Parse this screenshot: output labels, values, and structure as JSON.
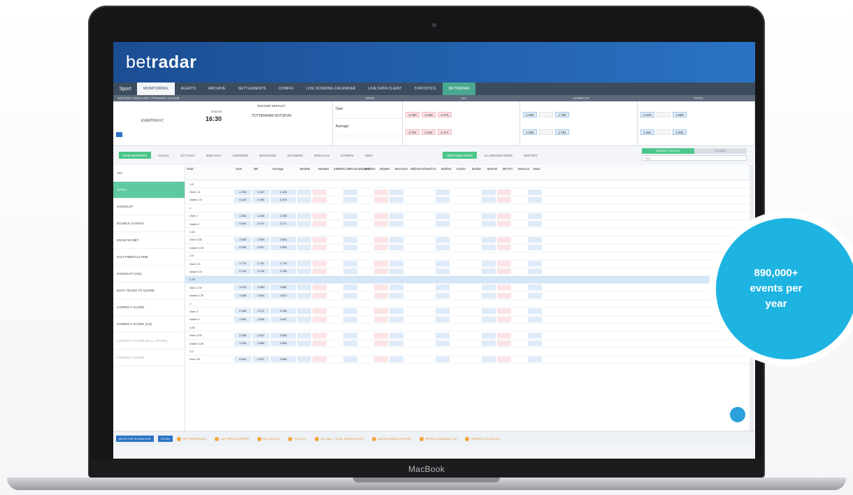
{
  "device": {
    "chin_label": "MacBook"
  },
  "brand": {
    "logo_prefix": "b",
    "logo_mid": "e",
    "logo_t": "t",
    "logo_bold": "radar"
  },
  "nav": {
    "logo_text": "Sport",
    "items": [
      "MONITORING",
      "ALERTS",
      "ARCHIVE",
      "SETTLEMENTS",
      "CONFIG",
      "LIVE SCORING CALENDAR",
      "LIVE DATA CLIENT",
      "STATISTICS",
      "BETRADAR"
    ]
  },
  "event_bar": {
    "path": "SOCCER / ENGLAND / PREMIER LEAGUE",
    "cols": [
      "ODDS",
      "1X2",
      "HANDICAP",
      "TOTAL"
    ]
  },
  "event": {
    "home": "EVERTON FC",
    "away": "TOTTENHAM HOTSPUR",
    "status": "STATUS",
    "time": "16:30",
    "profile": "SOCCER DEFAULT",
    "rows": [
      "Own",
      "Average"
    ],
    "odds_1x2": [
      [
        "2.760",
        "3.460",
        "2.476"
      ],
      [
        "2.751",
        "3.342",
        "2.471"
      ]
    ],
    "odds_hcp": [
      [
        "1.900",
        "",
        "1.790"
      ],
      [
        "1.892",
        "",
        "1.761"
      ]
    ],
    "odds_total": [
      [
        "1.975",
        "",
        "1.556"
      ],
      [
        "1.861",
        "",
        "1.932"
      ]
    ]
  },
  "filters": {
    "left": [
      "MAIN MARKETS",
      "GOALS",
      "1ST HALF",
      "2ND HALF",
      "CORNERS",
      "BOOKINGS",
      "SCORERS",
      "SPECIALS",
      "OTHERS",
      "MISC"
    ],
    "right": [
      "WATCHED ODDS",
      "ALL BOOKMAKERS",
      "HISTORY"
    ],
    "tabs": [
      "MARKET GROUPS",
      "FILTERS"
    ],
    "search_placeholder": "Find"
  },
  "sidebar": [
    "1X2",
    "TOTAL",
    "HANDICAP",
    "DOUBLE CHANCE",
    "DRAW NO BET",
    "HALFTIME/FULLTIME",
    "HANDICAP (1X2)",
    "BOTH TEAMS TO SCORE",
    "CORRECT SCORE",
    "CORRECT SCORE (3:0)",
    "CORRECT SCORE (INCL. OTHER)",
    "CORRECT SCORE"
  ],
  "grid": {
    "headers": [
      "Total",
      "Own",
      "BR",
      "Average",
      "Bet365",
      "MaxBet",
      "188BetCom",
      "PinnacleSports",
      "SBObet",
      "SkyBet",
      "BetVictor",
      "WilliamHill",
      "BetCris",
      "Betfred",
      "Kambi",
      "Betfair",
      "BetFair",
      "BETFA",
      "Betsson",
      "Bwin"
    ],
    "rows": [
      {
        "label": "1.5",
        "own": "",
        "br": "",
        "avg": "",
        "hl": false
      },
      {
        "label": "Over 1.5",
        "own": "1.236",
        "br": "1.247",
        "avg": "1.228",
        "hl": false
      },
      {
        "label": "Under 1.5",
        "own": "4.125",
        "br": "4.300",
        "avg": "4.003",
        "hl": false
      },
      {
        "label": "2",
        "own": "",
        "br": "",
        "avg": "",
        "hl": false
      },
      {
        "label": "Over 2",
        "own": "1.360",
        "br": "1.406",
        "avg": "1.338",
        "hl": false
      },
      {
        "label": "Under 2",
        "own": "3.000",
        "br": "3.107",
        "avg": "3.171",
        "hl": false
      },
      {
        "label": "2.25",
        "own": "",
        "br": "",
        "avg": "",
        "hl": false
      },
      {
        "label": "Over 2.25",
        "own": "1.536",
        "br": "1.505",
        "avg": "1.504",
        "hl": false
      },
      {
        "label": "Under 2.25",
        "own": "2.538",
        "br": "2.507",
        "avg": "2.559",
        "hl": false
      },
      {
        "label": "2.5",
        "own": "",
        "br": "",
        "avg": "",
        "hl": false
      },
      {
        "label": "Over 2.5",
        "own": "1.776",
        "br": "1.751",
        "avg": "1.778",
        "hl": false
      },
      {
        "label": "Under 2.5",
        "own": "2.149",
        "br": "2.149",
        "avg": "2.138",
        "hl": false
      },
      {
        "label": "2.75",
        "own": "",
        "br": "",
        "avg": "",
        "hl": true
      },
      {
        "label": "Over 2.75",
        "own": "1.976",
        "br": "1.983",
        "avg": "1.881",
        "hl": false
      },
      {
        "label": "Under 2.75",
        "own": "1.536",
        "br": "1.824",
        "avg": "1.812",
        "hl": false
      },
      {
        "label": "3",
        "own": "",
        "br": "",
        "avg": "",
        "hl": false
      },
      {
        "label": "Over 3",
        "own": "2.266",
        "br": "2.271",
        "avg": "2.266",
        "hl": false
      },
      {
        "label": "Under 3",
        "own": "1.690",
        "br": "1.696",
        "avg": "1.687",
        "hl": false
      },
      {
        "label": "3.25",
        "own": "",
        "br": "",
        "avg": "",
        "hl": false
      },
      {
        "label": "Over 3.25",
        "own": "2.538",
        "br": "2.512",
        "avg": "2.583",
        "hl": false
      },
      {
        "label": "Under 3.25",
        "own": "1.536",
        "br": "1.583",
        "avg": "1.564",
        "hl": false
      },
      {
        "label": "3.5",
        "own": "",
        "br": "",
        "avg": "",
        "hl": false
      },
      {
        "label": "Over 3.5",
        "own": "2.818",
        "br": "2.871",
        "avg": "2.883",
        "hl": false
      }
    ]
  },
  "footer": {
    "mute": "MUTE FOR 30 MINUTES",
    "close": "CLOSE",
    "warnings": [
      "OFF SUSPENSION",
      "LIMIT BREACH ERROR",
      "MAX STAKES",
      "TOTAL 2.5",
      "1ST HALF - TOTAL CORNERS (4.5)",
      "LIMITING BREACH ERROR",
      "DEFINED HANDICAP 1.5s",
      "CORRECT SCORE (0:1)"
    ]
  },
  "callout": {
    "text": "890,000+\nevents per\nyear",
    "color": "#1eb4e2"
  },
  "colors": {
    "header": "#1b4d93",
    "accent_green": "#4cc58a",
    "accent_teal": "#4aa88f",
    "odds_pink": "#fbe3e6",
    "odds_blue": "#deebf8"
  }
}
